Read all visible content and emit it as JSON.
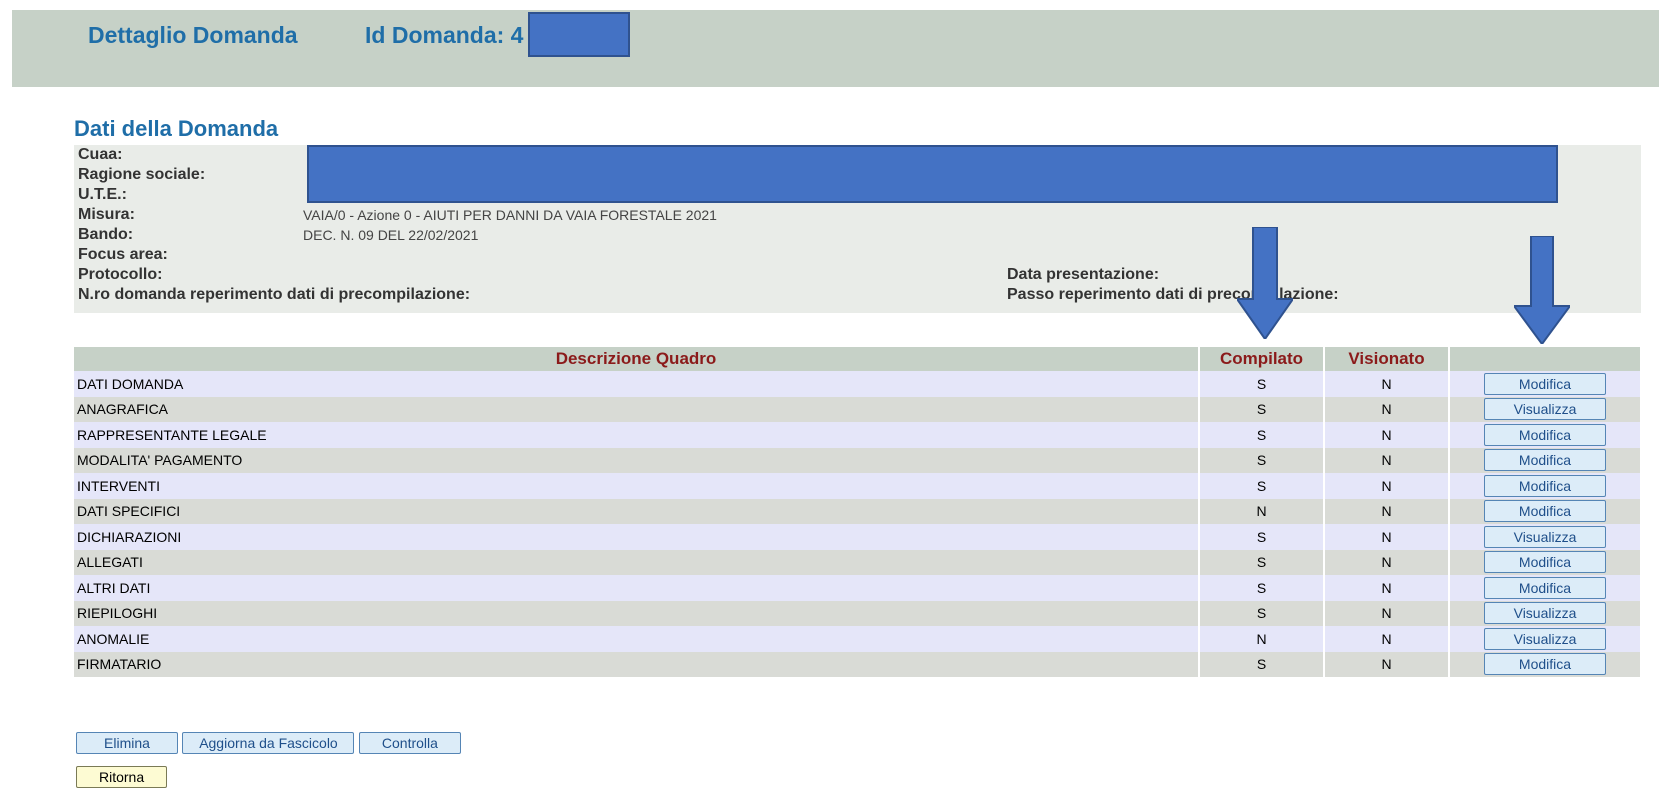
{
  "header": {
    "title": "Dettaglio Domanda",
    "id_label": "Id Domanda: 4"
  },
  "section": {
    "title": "Dati della Domanda"
  },
  "info": {
    "cuaa_label": "Cuaa:",
    "ragione_sociale_label": "Ragione sociale:",
    "ute_label": "U.T.E.:",
    "misura_label": "Misura:",
    "misura_value": "VAIA/0 - Azione 0 - AIUTI PER DANNI DA VAIA FORESTALE 2021",
    "bando_label": "Bando:",
    "bando_value": "DEC. N. 09 DEL 22/02/2021",
    "focus_area_label": "Focus area:",
    "protocollo_label": "Protocollo:",
    "nro_domanda_label": "N.ro domanda reperimento dati di precompilazione:",
    "data_presentazione_label": "Data presentazione:",
    "passo_label": "Passo reperimento dati di precompilazione:"
  },
  "table": {
    "headers": [
      "Descrizione Quadro",
      "Compilato",
      "Visionato",
      ""
    ],
    "rows": [
      {
        "descrizione": "DATI DOMANDA",
        "compilato": "S",
        "visionato": "N",
        "action": "Modifica"
      },
      {
        "descrizione": "ANAGRAFICA",
        "compilato": "S",
        "visionato": "N",
        "action": "Visualizza"
      },
      {
        "descrizione": "RAPPRESENTANTE LEGALE",
        "compilato": "S",
        "visionato": "N",
        "action": "Modifica"
      },
      {
        "descrizione": "MODALITA' PAGAMENTO",
        "compilato": "S",
        "visionato": "N",
        "action": "Modifica"
      },
      {
        "descrizione": "INTERVENTI",
        "compilato": "S",
        "visionato": "N",
        "action": "Modifica"
      },
      {
        "descrizione": "DATI SPECIFICI",
        "compilato": "N",
        "visionato": "N",
        "action": "Modifica"
      },
      {
        "descrizione": "DICHIARAZIONI",
        "compilato": "S",
        "visionato": "N",
        "action": "Visualizza"
      },
      {
        "descrizione": "ALLEGATI",
        "compilato": "S",
        "visionato": "N",
        "action": "Modifica"
      },
      {
        "descrizione": "ALTRI DATI",
        "compilato": "S",
        "visionato": "N",
        "action": "Modifica"
      },
      {
        "descrizione": "RIEPILOGHI",
        "compilato": "S",
        "visionato": "N",
        "action": "Visualizza"
      },
      {
        "descrizione": "ANOMALIE",
        "compilato": "N",
        "visionato": "N",
        "action": "Visualizza"
      },
      {
        "descrizione": "FIRMATARIO",
        "compilato": "S",
        "visionato": "N",
        "action": "Modifica"
      }
    ]
  },
  "actions": {
    "elimina": "Elimina",
    "aggiorna": "Aggiorna da Fascicolo",
    "controlla": "Controlla",
    "ritorna": "Ritorna"
  },
  "colors": {
    "header_bg": "#c6d1c7",
    "title_blue": "#1f6ea8",
    "table_header_red": "#8b1a1a",
    "redaction_blue": "#4472c4",
    "arrow_blue": "#4472c4"
  }
}
